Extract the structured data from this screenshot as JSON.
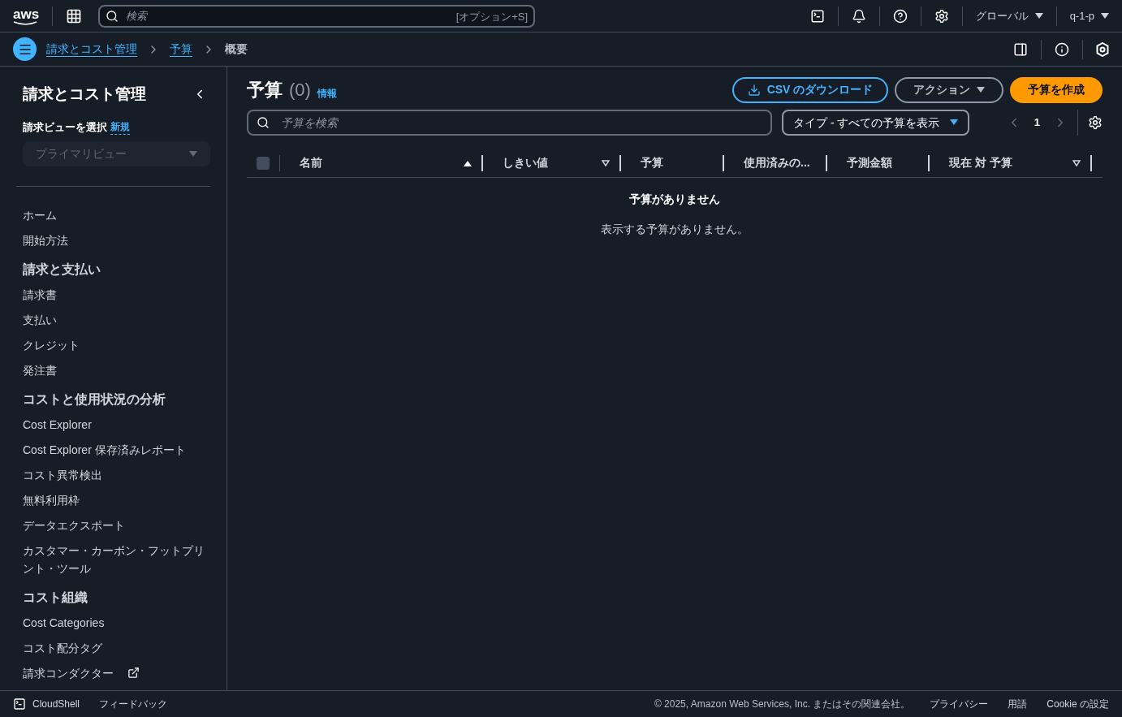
{
  "top_bar": {
    "logo": "aws",
    "search": {
      "placeholder": "検索",
      "shortcut": "[オプション+S]"
    },
    "region": "グローバル",
    "account": "q-1-p"
  },
  "breadcrumbs": [
    {
      "label": "請求とコスト管理",
      "kind": "link"
    },
    {
      "label": "予算",
      "kind": "link"
    },
    {
      "label": "概要",
      "kind": "current"
    }
  ],
  "sidebar": {
    "title": "請求とコスト管理",
    "view_label": "請求ビューを選択",
    "view_new": "新規",
    "view_select": {
      "value": "プライマリビュー",
      "disabled": true
    },
    "items": [
      {
        "label": "ホーム",
        "kind": "link"
      },
      {
        "label": "開始方法",
        "kind": "link"
      },
      {
        "label": "請求と支払い",
        "kind": "heading"
      },
      {
        "label": "請求書",
        "kind": "link"
      },
      {
        "label": "支払い",
        "kind": "link"
      },
      {
        "label": "クレジット",
        "kind": "link"
      },
      {
        "label": "発注書",
        "kind": "link"
      },
      {
        "label": "コストと使用状況の分析",
        "kind": "heading"
      },
      {
        "label": "Cost Explorer",
        "kind": "link"
      },
      {
        "label": "Cost Explorer 保存済みレポート",
        "kind": "link"
      },
      {
        "label": "コスト異常検出",
        "kind": "link"
      },
      {
        "label": "無料利用枠",
        "kind": "link"
      },
      {
        "label": "データエクスポート",
        "kind": "link"
      },
      {
        "label": "カスタマー・カーボン・フットプリント・ツール",
        "kind": "link"
      },
      {
        "label": "コスト組織",
        "kind": "heading"
      },
      {
        "label": "Cost Categories",
        "kind": "link"
      },
      {
        "label": "コスト配分タグ",
        "kind": "link"
      },
      {
        "label": "請求コンダクター",
        "kind": "external"
      }
    ]
  },
  "main": {
    "title": "予算",
    "count": "(0)",
    "info": "情報",
    "buttons": [
      {
        "label": "CSV のダウンロード",
        "kind": "download"
      },
      {
        "label": "アクション",
        "kind": "dropdown"
      },
      {
        "label": "予算を作成",
        "kind": "primary"
      }
    ],
    "search": {
      "placeholder": "予算を検索"
    },
    "filter": "タイプ - すべての予算を表示",
    "page": "1",
    "table": {
      "select_all": {
        "checked": false
      },
      "columns": [
        {
          "label": "名前",
          "sortable": true,
          "sorted": true
        },
        {
          "label": "しきい値",
          "sortable": true,
          "sorted": false
        },
        {
          "label": "予算"
        },
        {
          "label": "使用済みの..."
        },
        {
          "label": "予測金額"
        },
        {
          "label": "現在 対 予算",
          "sortable": true,
          "sorted": false
        }
      ],
      "empty_title": "予算がありません",
      "empty_text": "表示する予算がありません。"
    }
  },
  "footer": {
    "cloudshell": "CloudShell",
    "feedback": "フィードバック",
    "copyright": "© 2025, Amazon Web Services, Inc. またはその関連会社。",
    "links": [
      "プライバシー",
      "用語",
      "Cookie の設定"
    ]
  }
}
